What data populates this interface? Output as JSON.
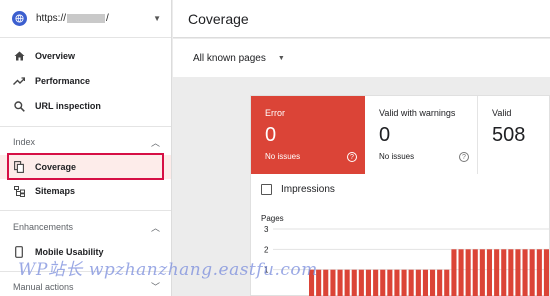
{
  "sidebar": {
    "property": {
      "prefix": "https://",
      "suffix": "/"
    },
    "items": [
      {
        "label": "Overview"
      },
      {
        "label": "Performance"
      },
      {
        "label": "URL inspection"
      }
    ],
    "index_section": {
      "label": "Index",
      "items": [
        {
          "label": "Coverage"
        },
        {
          "label": "Sitemaps"
        }
      ]
    },
    "enhancements_section": {
      "label": "Enhancements",
      "items": [
        {
          "label": "Mobile Usability"
        }
      ]
    },
    "manual_section": {
      "label": "Manual actions"
    }
  },
  "header": {
    "title": "Coverage"
  },
  "filter": {
    "selected": "All known pages"
  },
  "summary": {
    "error": {
      "label": "Error",
      "value": "0",
      "sub": "No issues",
      "color": "#db4437"
    },
    "warnings": {
      "label": "Valid with warnings",
      "value": "0",
      "sub": "No issues"
    },
    "valid": {
      "label": "Valid",
      "value": "508"
    }
  },
  "impressions_label": "Impressions",
  "chart_data": {
    "type": "bar",
    "ylabel": "Pages",
    "ylim": [
      0,
      3
    ],
    "yticks": [
      "3",
      "2",
      "1"
    ],
    "series": [
      {
        "values": [
          1,
          1,
          1,
          1,
          1,
          1,
          1,
          1,
          1,
          1,
          1,
          1,
          1,
          1,
          1,
          1,
          1,
          1,
          1,
          1,
          2,
          2,
          2,
          2,
          2,
          2,
          2,
          2,
          2,
          2,
          2,
          2,
          2,
          2
        ],
        "color": "#db4437"
      }
    ]
  },
  "watermark": "WP站长 wpzhanzhang.eastfu.com"
}
